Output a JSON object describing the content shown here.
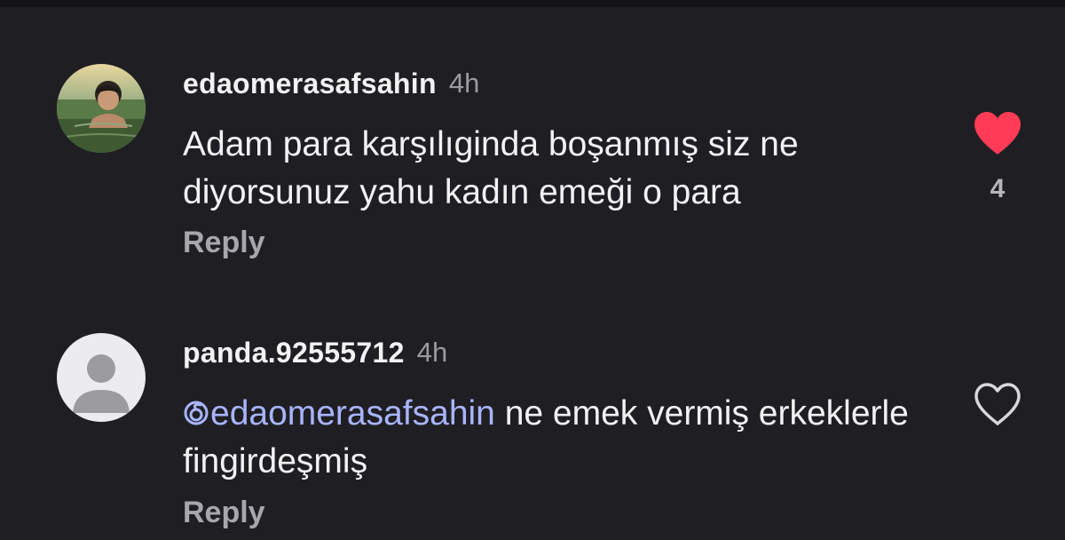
{
  "colors": {
    "background": "#1f1f23",
    "text": "#f2f2f2",
    "muted": "#9a9aa0",
    "mention": "#a9b4ff",
    "like_active": "#ff3b55"
  },
  "comments": [
    {
      "username": "edaomerasafsahin",
      "time": "4h",
      "text": "Adam para karşılıginda boşanmış siz ne diyorsunuz yahu kadın emeği o para",
      "reply_label": "Reply",
      "liked": true,
      "like_icon": "heart-filled-icon",
      "like_count": "4",
      "avatar": "profile-photo"
    },
    {
      "username": "panda.92555712",
      "time": "4h",
      "mention": "edaomerasafsahin",
      "text": " ne emek vermiş erkeklerle fingirdeşmiş",
      "reply_label": "Reply",
      "liked": false,
      "like_icon": "heart-outline-icon",
      "avatar": "default-avatar"
    }
  ]
}
